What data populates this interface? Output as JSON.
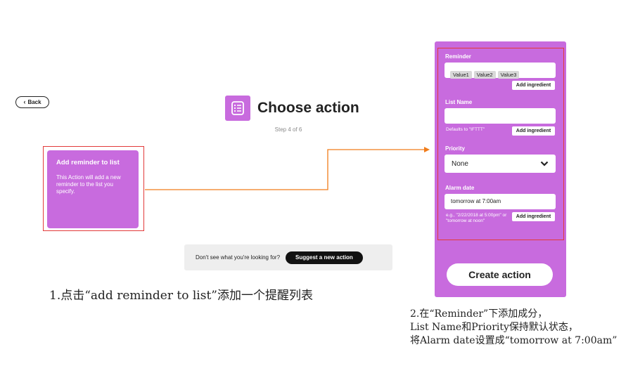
{
  "nav": {
    "back_label": "Back"
  },
  "header": {
    "title": "Choose action",
    "step": "Step 4 of 6"
  },
  "action_card": {
    "title": "Add reminder to list",
    "description": "This Action will add a new reminder to the list you specify."
  },
  "suggest": {
    "prompt": "Don't see what you're looking for?",
    "button_label": "Suggest a new action"
  },
  "form": {
    "reminder": {
      "label": "Reminder",
      "chips": [
        "Value1",
        "Value2",
        "Value3"
      ],
      "ingredient_label": "Add ingredient"
    },
    "list_name": {
      "label": "List Name",
      "value": "",
      "hint": "Defaults to \"IFTTT\"",
      "ingredient_label": "Add ingredient"
    },
    "priority": {
      "label": "Priority",
      "selected": "None"
    },
    "alarm_date": {
      "label": "Alarm date",
      "value": "tomorrow at 7:00am",
      "hint": "e.g., \"2/22/2018 at 5:00pm\" or \"tomorrow at noon\"",
      "ingredient_label": "Add ingredient"
    },
    "create_label": "Create action"
  },
  "annotations": {
    "caption1": "1.点击“add reminder to list”添加一个提醒列表",
    "caption2_line1": "2.在“Reminder”下添加成分，",
    "caption2_line2": "List Name和Priority保持默认状态，",
    "caption2_line3": "将Alarm date设置成“tomorrow at 7:00am”"
  },
  "colors": {
    "accent": "#c86bde",
    "highlight": "#e23a3a",
    "connector": "#f07c1a"
  }
}
